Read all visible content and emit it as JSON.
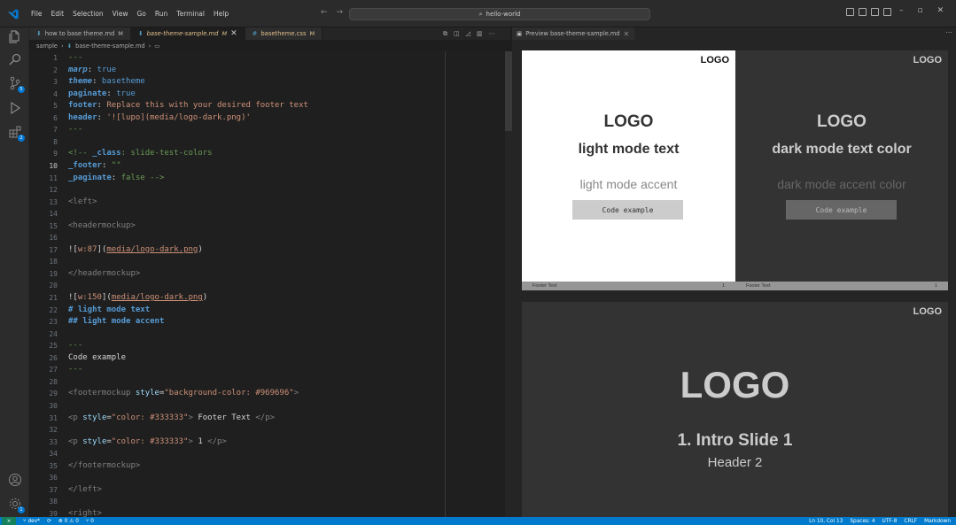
{
  "titlebar": {
    "menu": [
      "File",
      "Edit",
      "Selection",
      "View",
      "Go",
      "Run",
      "Terminal",
      "Help"
    ],
    "search_text": "hello-world"
  },
  "tabs": [
    {
      "label": "how to base theme.md",
      "badge": "M",
      "active": false
    },
    {
      "label": "base-theme-sample.md",
      "badge": "M",
      "active": true
    },
    {
      "label": "basetheme.css",
      "badge": "M",
      "active": false
    }
  ],
  "breadcrumb": [
    "sample",
    "base-theme-sample.md",
    "▭"
  ],
  "editor": {
    "current_line": 10,
    "lines": [
      {
        "n": "1",
        "t": "---"
      },
      {
        "n": "2",
        "t": "marp: true"
      },
      {
        "n": "3",
        "t": "theme: basetheme"
      },
      {
        "n": "4",
        "t": "paginate: true"
      },
      {
        "n": "5",
        "t": "footer: Replace this with your desired footer text"
      },
      {
        "n": "6",
        "t": "header: '![lupo](media/logo-dark.png)'"
      },
      {
        "n": "7",
        "t": "---"
      },
      {
        "n": "8",
        "t": ""
      },
      {
        "n": "9",
        "t": "<!-- _class: slide-test-colors"
      },
      {
        "n": "10",
        "t": "_footer: \"\""
      },
      {
        "n": "11",
        "t": "_paginate: false -->"
      },
      {
        "n": "12",
        "t": ""
      },
      {
        "n": "13",
        "t": "<left>"
      },
      {
        "n": "14",
        "t": ""
      },
      {
        "n": "15",
        "t": "<headermockup>"
      },
      {
        "n": "16",
        "t": ""
      },
      {
        "n": "17",
        "t": "![w:87](media/logo-dark.png)"
      },
      {
        "n": "18",
        "t": ""
      },
      {
        "n": "19",
        "t": "</headermockup>"
      },
      {
        "n": "20",
        "t": ""
      },
      {
        "n": "21",
        "t": "![w:150](media/logo-dark.png)"
      },
      {
        "n": "22",
        "t": "# light mode text"
      },
      {
        "n": "23",
        "t": "## light mode accent"
      },
      {
        "n": "24",
        "t": ""
      },
      {
        "n": "25",
        "t": "---"
      },
      {
        "n": "26",
        "t": "Code example"
      },
      {
        "n": "27",
        "t": "---"
      },
      {
        "n": "28",
        "t": ""
      },
      {
        "n": "29",
        "t": "<footermockup style=\"background-color: #969696\">"
      },
      {
        "n": "30",
        "t": ""
      },
      {
        "n": "31",
        "t": "<p style=\"color: #333333\"> Footer Text </p>"
      },
      {
        "n": "32",
        "t": ""
      },
      {
        "n": "33",
        "t": "<p style=\"color: #333333\"> 1 </p>"
      },
      {
        "n": "34",
        "t": ""
      },
      {
        "n": "35",
        "t": "</footermockup>"
      },
      {
        "n": "36",
        "t": ""
      },
      {
        "n": "37",
        "t": "</left>"
      },
      {
        "n": "38",
        "t": ""
      },
      {
        "n": "39",
        "t": "<right>"
      }
    ]
  },
  "preview": {
    "tab_label": "Preview base-theme-sample.md",
    "slide_light": {
      "corner_logo": "LOGO",
      "logo": "LOGO",
      "heading": "light mode text",
      "accent": "light mode accent",
      "code": "Code example",
      "footer_text": "Footer Text",
      "page": "1"
    },
    "slide_dark": {
      "corner_logo": "LOGO",
      "logo": "LOGO",
      "heading": "dark mode text color",
      "accent": "dark mode accent color",
      "code": "Code example",
      "footer_text": "Footer Text",
      "page": "1"
    },
    "slide_intro": {
      "corner_logo": "LOGO",
      "logo": "LOGO",
      "heading": "1. Intro Slide 1",
      "subheading": "Header 2"
    }
  },
  "statusbar": {
    "branch": "dev*",
    "sync": "⟳",
    "problems": "⊗ 0 ⚠ 0",
    "ports": "⑂ 0",
    "position": "Ln 10, Col 13",
    "spaces": "Spaces: 4",
    "encoding": "UTF-8",
    "eol": "CRLF",
    "language": "Markdown"
  },
  "colors": {
    "accent": "#007acc",
    "slide_dark_bg": "#333333",
    "footer_bg": "#969696"
  }
}
